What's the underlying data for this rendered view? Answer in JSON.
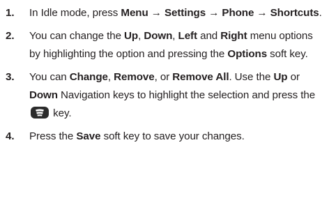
{
  "steps": [
    {
      "number": "1.",
      "parts": [
        {
          "t": "In Idle mode, press "
        },
        {
          "t": "Menu → Settings → Phone → Shortcuts",
          "b": true
        },
        {
          "t": "."
        }
      ]
    },
    {
      "number": "2.",
      "parts": [
        {
          "t": "You can change the "
        },
        {
          "t": "Up",
          "b": true
        },
        {
          "t": ", "
        },
        {
          "t": "Down",
          "b": true
        },
        {
          "t": ", "
        },
        {
          "t": "Left",
          "b": true
        },
        {
          "t": " and "
        },
        {
          "t": "Right",
          "b": true
        },
        {
          "t": " menu options by highlighting the option and pressing the "
        },
        {
          "t": "Options",
          "b": true
        },
        {
          "t": " soft key."
        }
      ]
    },
    {
      "number": "3.",
      "parts": [
        {
          "t": "You can "
        },
        {
          "t": "Change",
          "b": true
        },
        {
          "t": ", "
        },
        {
          "t": "Remove",
          "b": true
        },
        {
          "t": ", or "
        },
        {
          "t": "Remove All",
          "b": true
        },
        {
          "t": ". Use the "
        },
        {
          "t": "Up",
          "b": true
        },
        {
          "t": " or "
        },
        {
          "t": "Down",
          "b": true
        },
        {
          "t": " Navigation keys to highlight the selection and press the "
        },
        {
          "icon": "ok-key-icon"
        },
        {
          "t": " key."
        }
      ]
    },
    {
      "number": "4.",
      "parts": [
        {
          "t": "Press the "
        },
        {
          "t": "Save",
          "b": true
        },
        {
          "t": " soft key to save your changes."
        }
      ]
    }
  ]
}
